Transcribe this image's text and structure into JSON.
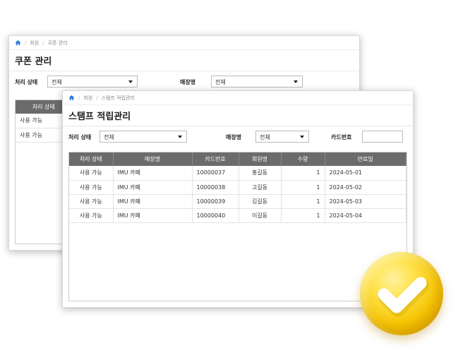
{
  "back_window": {
    "breadcrumb": [
      "회원",
      "쿠폰 관리"
    ],
    "title": "쿠폰 관리",
    "filters": {
      "status_label": "처리 상태",
      "status_value": "전체",
      "store_label": "매장명",
      "store_value": "전체"
    },
    "table": {
      "header": "처리 상태",
      "rows": [
        "사용 가능",
        "사용 가능"
      ]
    }
  },
  "front_window": {
    "breadcrumb": [
      "회원",
      "스탬프 적립관리"
    ],
    "title": "스탬프 적립관리",
    "filters": {
      "status_label": "처리 상태",
      "status_value": "전체",
      "store_label": "매장명",
      "store_value": "전체",
      "card_label": "카드번호",
      "card_value": ""
    },
    "table": {
      "columns": [
        "처리 상태",
        "매장명",
        "카드번호",
        "회원명",
        "수량",
        "만료일"
      ],
      "rows": [
        [
          "사용 가능",
          "IMU 카페",
          "10000037",
          "홍길동",
          "1",
          "2024-05-01"
        ],
        [
          "사용 가능",
          "IMU 카페",
          "10000038",
          "고길동",
          "1",
          "2024-05-02"
        ],
        [
          "사용 가능",
          "IMU 카페",
          "10000039",
          "김길동",
          "1",
          "2024-05-03"
        ],
        [
          "사용 가능",
          "IMU 카페",
          "10000040",
          "이길동",
          "1",
          "2024-05-04"
        ]
      ]
    }
  },
  "colors": {
    "home_icon": "#2a7ad8",
    "table_header": "#6b6b6b",
    "badge": "#f5c400"
  },
  "icons": [
    "home-icon",
    "chevron-down-icon",
    "check-icon"
  ]
}
